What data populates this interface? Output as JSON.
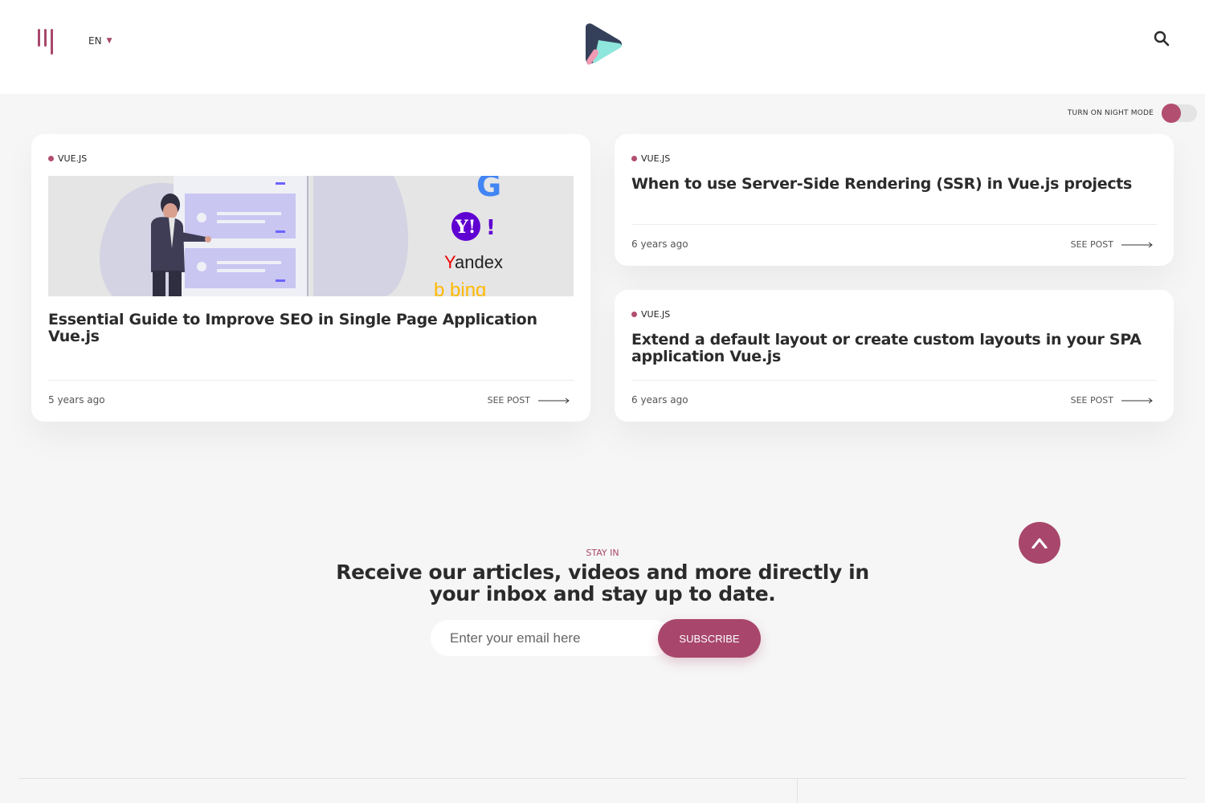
{
  "header": {
    "language": "EN",
    "menu_icon": "menu-bars-icon",
    "logo": "play-logo",
    "search_icon": "search-icon"
  },
  "night_mode": {
    "label": "TURN ON NIGHT MODE",
    "enabled": false
  },
  "posts": [
    {
      "tag": "VUE.JS",
      "title": "Essential Guide to Improve SEO in Single Page Application Vue.js",
      "date": "5 years ago",
      "cta": "SEE POST",
      "thumbnail_logos": [
        "G",
        "Y!",
        "Yandex",
        "bing"
      ]
    },
    {
      "tag": "VUE.JS",
      "title": "When to use Server-Side Rendering (SSR) in Vue.js projects",
      "date": "6 years ago",
      "cta": "SEE POST"
    },
    {
      "tag": "VUE.JS",
      "title": "Extend a default layout or create custom layouts in your SPA application Vue.js",
      "date": "6 years ago",
      "cta": "SEE POST"
    }
  ],
  "newsletter": {
    "eyebrow": "STAY IN",
    "title": "Receive our articles, videos and more directly in your inbox and stay up to date.",
    "email_placeholder": "Enter your email here",
    "button_label": "SUBSCRIBE"
  },
  "colors": {
    "accent": "#a8476b",
    "background": "#f6f6f6",
    "card": "#ffffff"
  }
}
